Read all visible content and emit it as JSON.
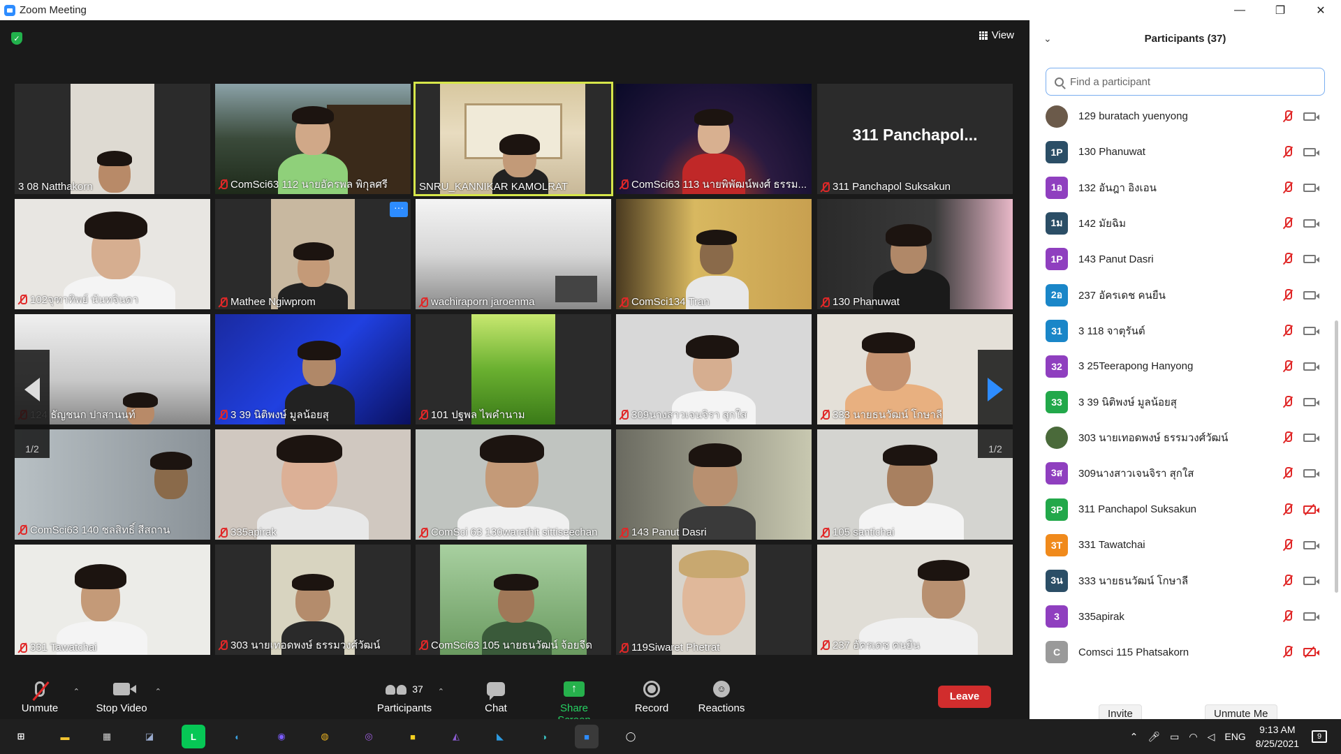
{
  "window": {
    "title": "Zoom Meeting",
    "minimize": "—",
    "restore": "❐",
    "close": "✕"
  },
  "meeting": {
    "view_label": "View",
    "page_indicator_left": "1/2",
    "page_indicator_right": "1/2",
    "speaker": "SNRU_KANNIKAR KAMOLRAT",
    "tiles": [
      "3 08 Natthakorn",
      "ComSci63 112 นายอัครพล พิกุลศรี",
      "SNRU_KANNIKAR KAMOLRAT",
      "ComSci63 113 นายพิพัฒน์พงศ์ ธรรม...",
      "311 Panchapol Suksakun",
      "102จุฑาทิพย์ นันทจินดา",
      "Mathee Ngiwprom",
      "wachiraporn jaroenma",
      "ComSci134 Tran",
      "130 Phanuwat",
      "124 ธัญชนก ปาสานนท์",
      "3 39 นิติพงษ์ มูลน้อยสุ",
      "101 ปฐพล ไพคำนาม",
      "309นางสาวเจนจิรา สุกใส",
      "333 นายธนวัฒน์ โกษาลี",
      "ComSci63 140 ชลสิทธิ์ สีสถาน",
      "335apirak",
      "ComSci 63 130warathit sittiseechan",
      "143 Panut Dasri",
      "105 santichai",
      "331 Tawatchai",
      "303 นายเทอดพงษ์ ธรรมวงศ์วัฒน์",
      "ComSci63 105 นายธนวัฒน์ จ้อยจีด",
      "119Siwaret Phetrat",
      "237 อัครเดช คนยืน"
    ],
    "no_video_name": "311 Panchapol..."
  },
  "toolbar": {
    "unmute": "Unmute",
    "stop_video": "Stop Video",
    "participants": "Participants",
    "participants_count": "37",
    "chat": "Chat",
    "share_screen": "Share Screen",
    "record": "Record",
    "reactions": "Reactions",
    "leave": "Leave"
  },
  "panel": {
    "title": "Participants (37)",
    "search_placeholder": "Find a participant",
    "invite": "Invite",
    "unmute_me": "Unmute Me",
    "participants": [
      {
        "initials": "",
        "name": "129 buratach yuenyong",
        "color": "#6b5a4a",
        "cam_off": false
      },
      {
        "initials": "1P",
        "name": "130 Phanuwat",
        "color": "#2b4e66",
        "cam_off": false
      },
      {
        "initials": "1อ",
        "name": "132 อันฎา อิงเอน",
        "color": "#8f3fbf",
        "cam_off": false
      },
      {
        "initials": "1ม",
        "name": "142 มัยฉิม",
        "color": "#2b4e66",
        "cam_off": false
      },
      {
        "initials": "1P",
        "name": "143 Panut Dasri",
        "color": "#8f3fbf",
        "cam_off": false
      },
      {
        "initials": "2อ",
        "name": "237 อัครเดช คนยืน",
        "color": "#1a86c8",
        "cam_off": false
      },
      {
        "initials": "31",
        "name": "3 118 จาตุรันต์",
        "color": "#1a86c8",
        "cam_off": false
      },
      {
        "initials": "32",
        "name": "3 25Teerapong Hanyong",
        "color": "#8f3fbf",
        "cam_off": false
      },
      {
        "initials": "33",
        "name": "3 39 นิติพงษ์ มูลน้อยสุ",
        "color": "#22a84a",
        "cam_off": false
      },
      {
        "initials": "",
        "name": "303 นายเทอดพงษ์ ธรรมวงศ์วัฒน์",
        "color": "#4a6a3a",
        "cam_off": false
      },
      {
        "initials": "3ส",
        "name": "309นางสาวเจนจิรา สุกใส",
        "color": "#8f3fbf",
        "cam_off": false
      },
      {
        "initials": "3P",
        "name": "311 Panchapol Suksakun",
        "color": "#22a84a",
        "cam_off": true
      },
      {
        "initials": "3T",
        "name": "331 Tawatchai",
        "color": "#f08a1c",
        "cam_off": false
      },
      {
        "initials": "3น",
        "name": "333 นายธนวัฒน์ โกษาลี",
        "color": "#2b4e66",
        "cam_off": false
      },
      {
        "initials": "3",
        "name": "335apirak",
        "color": "#8f3fbf",
        "cam_off": false
      },
      {
        "initials": "C",
        "name": "Comsci 115 Phatsakorn",
        "color": "#9a9a9a",
        "cam_off": true
      }
    ]
  },
  "taskbar": {
    "time": "9:13 AM",
    "date": "8/25/2021",
    "language": "ENG",
    "notifications": "9"
  }
}
